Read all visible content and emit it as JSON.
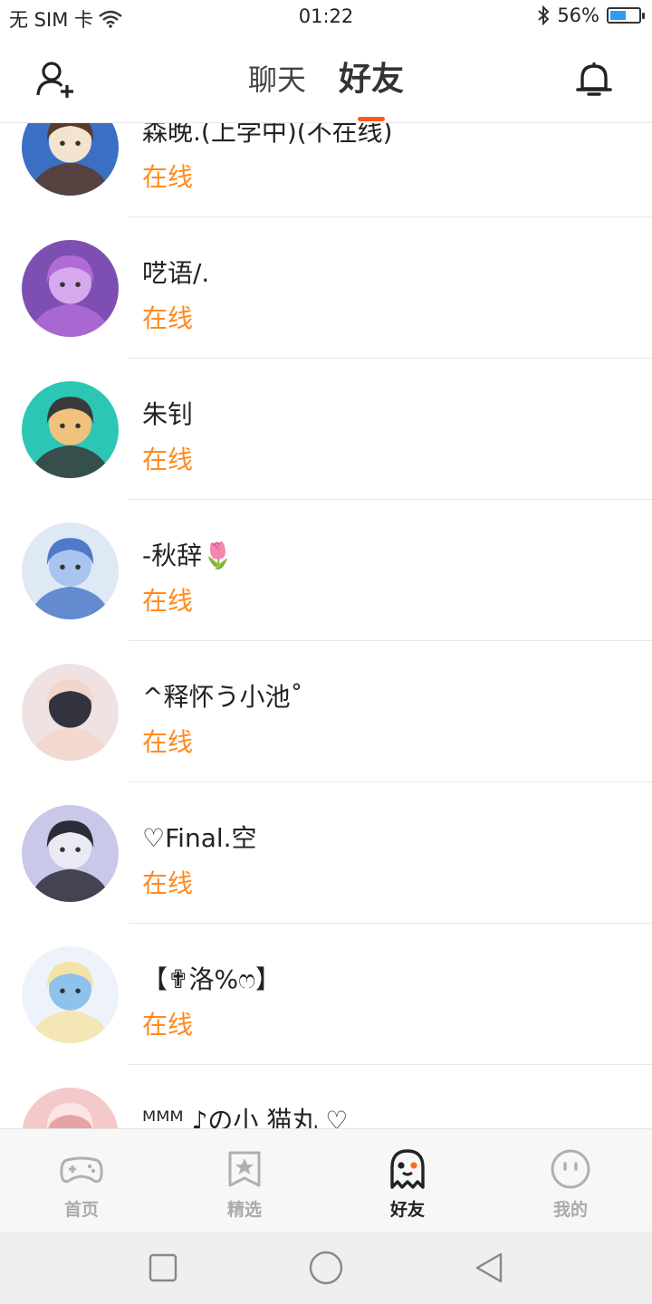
{
  "status_bar": {
    "carrier": "无 SIM 卡",
    "time": "01:22",
    "battery": "56%",
    "battery_level": 0.56,
    "wifi_icon": "wifi-icon",
    "bluetooth_icon": "bluetooth-icon"
  },
  "header": {
    "tabs": [
      {
        "label": "聊天",
        "active": false
      },
      {
        "label": "好友",
        "active": true
      }
    ],
    "left_icon": "add-friend-icon",
    "right_icon": "bell-icon",
    "accent_color": "#ff5a1f"
  },
  "friends": [
    {
      "name": "森晚.(上学中)(不在线)",
      "status": "在线"
    },
    {
      "name": "呓语/.",
      "status": "在线"
    },
    {
      "name": "朱钊",
      "status": "在线"
    },
    {
      "name": "-秋辞🌷",
      "status": "在线"
    },
    {
      "name": "^释怀う小池˚",
      "status": "在线"
    },
    {
      "name": "♡Final.空",
      "status": "在线"
    },
    {
      "name": "【✟洛%ෆ】",
      "status": "在线"
    },
    {
      "name": "ᴹᴹᴹ ♪の小 猫丸 ♡",
      "status": ""
    }
  ],
  "status_color": "#ff8a1f",
  "bottom_nav": [
    {
      "label": "首页",
      "icon": "gamepad-icon",
      "active": false
    },
    {
      "label": "精选",
      "icon": "star-bookmark-icon",
      "active": false
    },
    {
      "label": "好友",
      "icon": "ghost-icon",
      "active": true
    },
    {
      "label": "我的",
      "icon": "face-icon",
      "active": false
    }
  ],
  "system_nav": [
    "recent-apps-icon",
    "home-icon",
    "back-icon"
  ]
}
